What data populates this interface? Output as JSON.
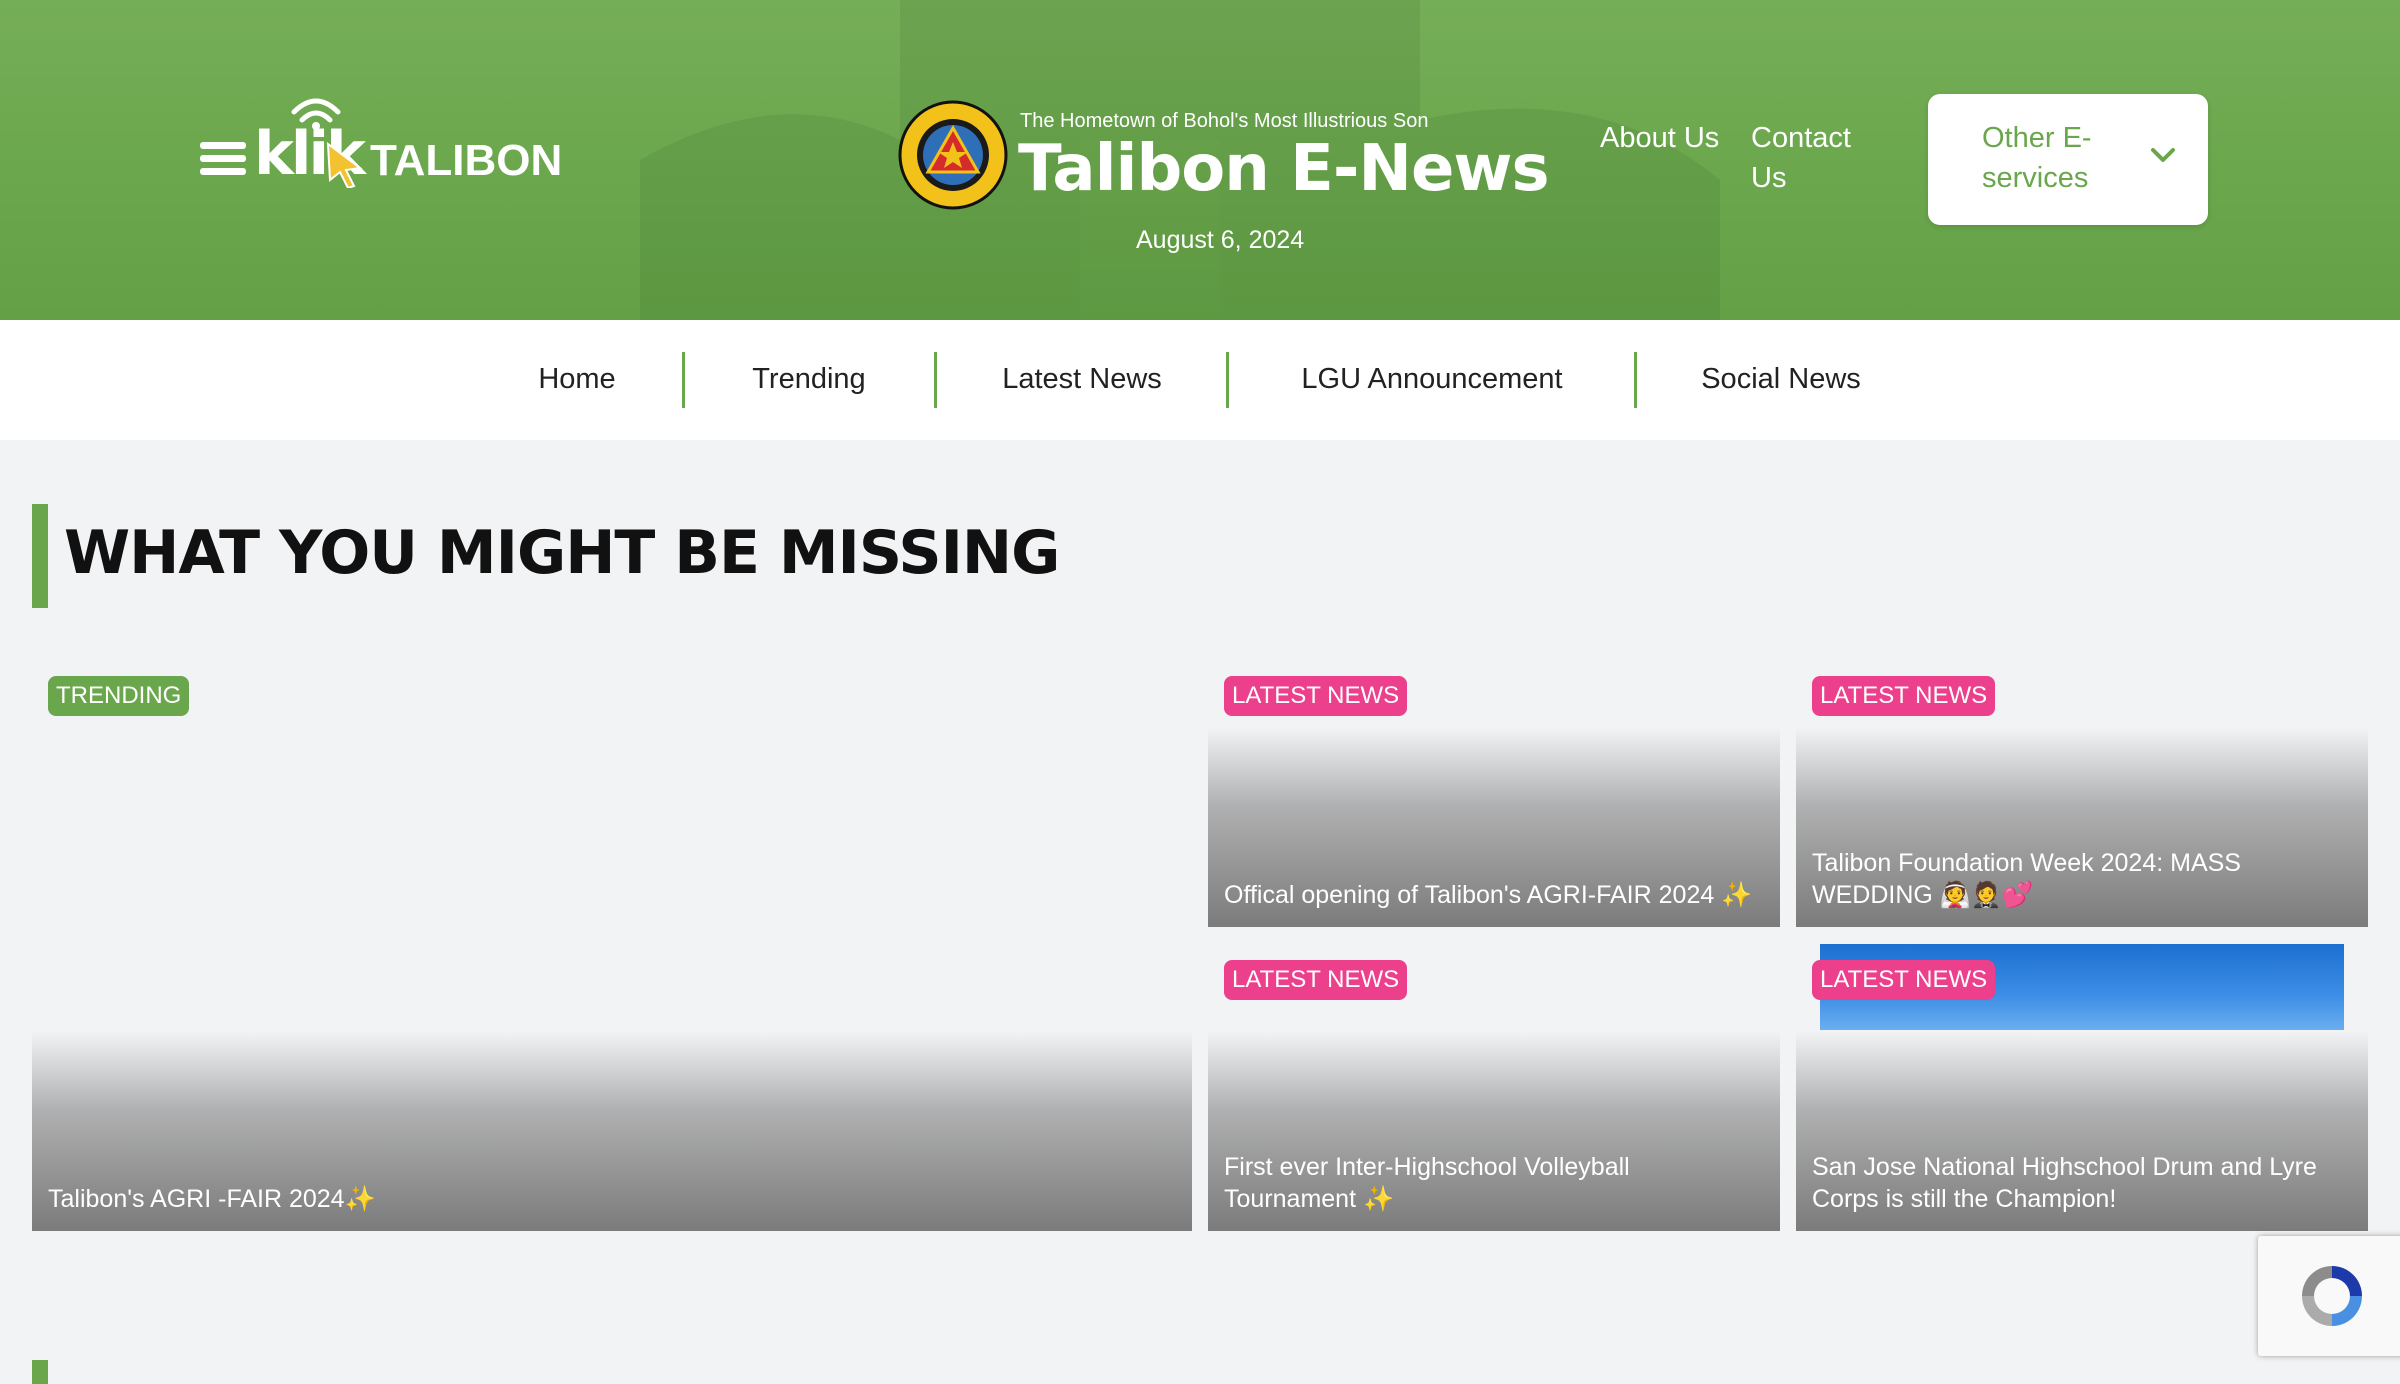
{
  "header": {
    "logo_text": "klik",
    "logo_sub": "TALIBON",
    "tagline": "The Hometown of Bohol's Most Illustrious Son",
    "site_title": "Talibon E-News",
    "date": "August 6, 2024",
    "links": [
      {
        "label": "About Us"
      },
      {
        "label": "Contact Us"
      }
    ],
    "eservices_label": "Other E-services",
    "seal_lettering": "MUNICIPALITY OF TALIBON · PROVINCE OF BOHOL"
  },
  "nav": {
    "items": [
      {
        "label": "Home"
      },
      {
        "label": "Trending"
      },
      {
        "label": "Latest News"
      },
      {
        "label": "LGU Announcement"
      },
      {
        "label": "Social News"
      }
    ]
  },
  "section": {
    "title": "WHAT YOU MIGHT BE MISSING",
    "cards": [
      {
        "badge": "TRENDING",
        "caption": "Talibon's AGRI -FAIR 2024✨",
        "badge_color": "#6aa64c"
      },
      {
        "badge": "LATEST NEWS",
        "caption": "Offical opening of Talibon's AGRI-FAIR 2024 ✨",
        "badge_color": "#ec3f8c"
      },
      {
        "badge": "LATEST NEWS",
        "caption": "Talibon Foundation Week 2024: MASS WEDDING 👰🤵💕",
        "badge_color": "#ec3f8c"
      },
      {
        "badge": "LATEST NEWS",
        "caption": "First ever Inter-Highschool Volleyball Tournament ✨",
        "badge_color": "#ec3f8c"
      },
      {
        "badge": "LATEST NEWS",
        "caption": "San Jose National Highschool Drum and Lyre Corps is still the Champion!",
        "badge_color": "#ec3f8c"
      }
    ]
  },
  "colors": {
    "brand_green": "#6aa64c",
    "badge_pink": "#ec3f8c",
    "page_bg": "#f2f3f5"
  }
}
